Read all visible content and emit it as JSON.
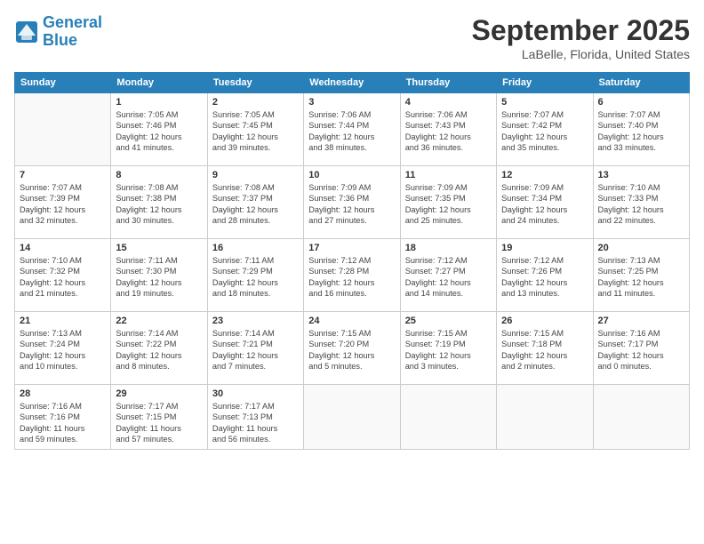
{
  "header": {
    "logo_line1": "General",
    "logo_line2": "Blue",
    "month": "September 2025",
    "location": "LaBelle, Florida, United States"
  },
  "days_of_week": [
    "Sunday",
    "Monday",
    "Tuesday",
    "Wednesday",
    "Thursday",
    "Friday",
    "Saturday"
  ],
  "weeks": [
    [
      {
        "day": "",
        "info": ""
      },
      {
        "day": "1",
        "info": "Sunrise: 7:05 AM\nSunset: 7:46 PM\nDaylight: 12 hours\nand 41 minutes."
      },
      {
        "day": "2",
        "info": "Sunrise: 7:05 AM\nSunset: 7:45 PM\nDaylight: 12 hours\nand 39 minutes."
      },
      {
        "day": "3",
        "info": "Sunrise: 7:06 AM\nSunset: 7:44 PM\nDaylight: 12 hours\nand 38 minutes."
      },
      {
        "day": "4",
        "info": "Sunrise: 7:06 AM\nSunset: 7:43 PM\nDaylight: 12 hours\nand 36 minutes."
      },
      {
        "day": "5",
        "info": "Sunrise: 7:07 AM\nSunset: 7:42 PM\nDaylight: 12 hours\nand 35 minutes."
      },
      {
        "day": "6",
        "info": "Sunrise: 7:07 AM\nSunset: 7:40 PM\nDaylight: 12 hours\nand 33 minutes."
      }
    ],
    [
      {
        "day": "7",
        "info": "Sunrise: 7:07 AM\nSunset: 7:39 PM\nDaylight: 12 hours\nand 32 minutes."
      },
      {
        "day": "8",
        "info": "Sunrise: 7:08 AM\nSunset: 7:38 PM\nDaylight: 12 hours\nand 30 minutes."
      },
      {
        "day": "9",
        "info": "Sunrise: 7:08 AM\nSunset: 7:37 PM\nDaylight: 12 hours\nand 28 minutes."
      },
      {
        "day": "10",
        "info": "Sunrise: 7:09 AM\nSunset: 7:36 PM\nDaylight: 12 hours\nand 27 minutes."
      },
      {
        "day": "11",
        "info": "Sunrise: 7:09 AM\nSunset: 7:35 PM\nDaylight: 12 hours\nand 25 minutes."
      },
      {
        "day": "12",
        "info": "Sunrise: 7:09 AM\nSunset: 7:34 PM\nDaylight: 12 hours\nand 24 minutes."
      },
      {
        "day": "13",
        "info": "Sunrise: 7:10 AM\nSunset: 7:33 PM\nDaylight: 12 hours\nand 22 minutes."
      }
    ],
    [
      {
        "day": "14",
        "info": "Sunrise: 7:10 AM\nSunset: 7:32 PM\nDaylight: 12 hours\nand 21 minutes."
      },
      {
        "day": "15",
        "info": "Sunrise: 7:11 AM\nSunset: 7:30 PM\nDaylight: 12 hours\nand 19 minutes."
      },
      {
        "day": "16",
        "info": "Sunrise: 7:11 AM\nSunset: 7:29 PM\nDaylight: 12 hours\nand 18 minutes."
      },
      {
        "day": "17",
        "info": "Sunrise: 7:12 AM\nSunset: 7:28 PM\nDaylight: 12 hours\nand 16 minutes."
      },
      {
        "day": "18",
        "info": "Sunrise: 7:12 AM\nSunset: 7:27 PM\nDaylight: 12 hours\nand 14 minutes."
      },
      {
        "day": "19",
        "info": "Sunrise: 7:12 AM\nSunset: 7:26 PM\nDaylight: 12 hours\nand 13 minutes."
      },
      {
        "day": "20",
        "info": "Sunrise: 7:13 AM\nSunset: 7:25 PM\nDaylight: 12 hours\nand 11 minutes."
      }
    ],
    [
      {
        "day": "21",
        "info": "Sunrise: 7:13 AM\nSunset: 7:24 PM\nDaylight: 12 hours\nand 10 minutes."
      },
      {
        "day": "22",
        "info": "Sunrise: 7:14 AM\nSunset: 7:22 PM\nDaylight: 12 hours\nand 8 minutes."
      },
      {
        "day": "23",
        "info": "Sunrise: 7:14 AM\nSunset: 7:21 PM\nDaylight: 12 hours\nand 7 minutes."
      },
      {
        "day": "24",
        "info": "Sunrise: 7:15 AM\nSunset: 7:20 PM\nDaylight: 12 hours\nand 5 minutes."
      },
      {
        "day": "25",
        "info": "Sunrise: 7:15 AM\nSunset: 7:19 PM\nDaylight: 12 hours\nand 3 minutes."
      },
      {
        "day": "26",
        "info": "Sunrise: 7:15 AM\nSunset: 7:18 PM\nDaylight: 12 hours\nand 2 minutes."
      },
      {
        "day": "27",
        "info": "Sunrise: 7:16 AM\nSunset: 7:17 PM\nDaylight: 12 hours\nand 0 minutes."
      }
    ],
    [
      {
        "day": "28",
        "info": "Sunrise: 7:16 AM\nSunset: 7:16 PM\nDaylight: 11 hours\nand 59 minutes."
      },
      {
        "day": "29",
        "info": "Sunrise: 7:17 AM\nSunset: 7:15 PM\nDaylight: 11 hours\nand 57 minutes."
      },
      {
        "day": "30",
        "info": "Sunrise: 7:17 AM\nSunset: 7:13 PM\nDaylight: 11 hours\nand 56 minutes."
      },
      {
        "day": "",
        "info": ""
      },
      {
        "day": "",
        "info": ""
      },
      {
        "day": "",
        "info": ""
      },
      {
        "day": "",
        "info": ""
      }
    ]
  ]
}
